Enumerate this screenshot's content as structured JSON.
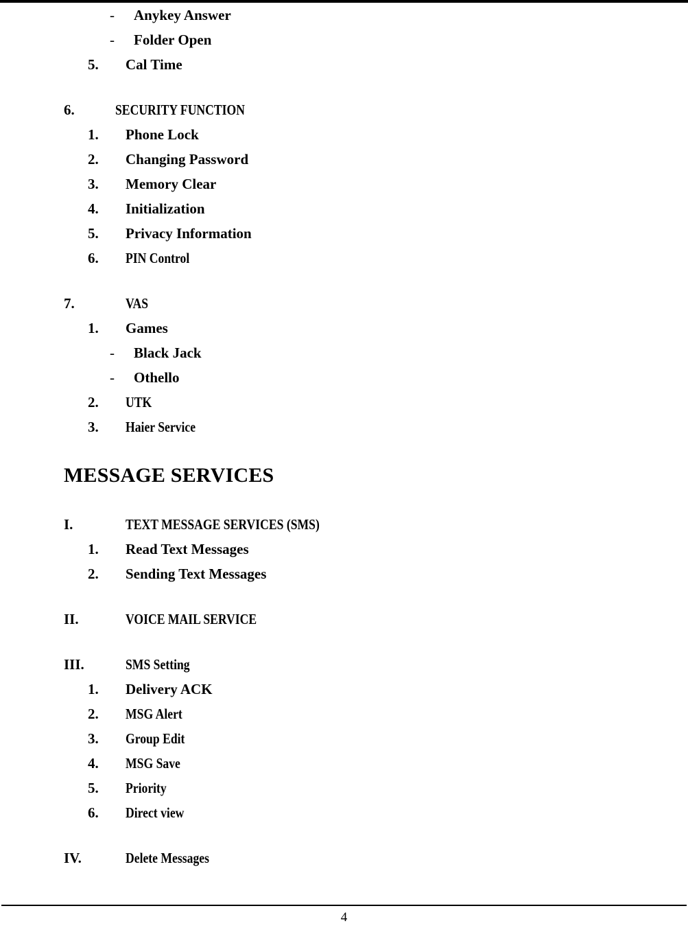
{
  "page": {
    "number": "4",
    "background_color": "#ffffff",
    "text_color": "#000000"
  },
  "continued_section": {
    "bullets": [
      {
        "marker": "-",
        "label": "Anykey Answer"
      },
      {
        "marker": "-",
        "label": "Folder Open"
      }
    ],
    "item": {
      "marker": "5.",
      "label": "Cal Time"
    }
  },
  "sections": [
    {
      "marker": "6.",
      "title": "SECURITY FUNCTION",
      "items": [
        {
          "marker": "1.",
          "label": "Phone Lock"
        },
        {
          "marker": "2.",
          "label": "Changing Password"
        },
        {
          "marker": "3.",
          "label": "Memory Clear"
        },
        {
          "marker": "4.",
          "label": "Initialization"
        },
        {
          "marker": "5.",
          "label": "Privacy Information"
        },
        {
          "marker": "6.",
          "label": "PIN Control"
        }
      ]
    },
    {
      "marker": "7.",
      "title": "VAS",
      "items": [
        {
          "marker": "1.",
          "label": "Games"
        },
        {
          "marker": "-",
          "label": "Black Jack"
        },
        {
          "marker": "-",
          "label": "Othello"
        },
        {
          "marker": "2.",
          "label": "UTK"
        },
        {
          "marker": "3.",
          "label": "Haier Service"
        }
      ]
    }
  ],
  "major_heading": "MESSAGE SERVICES",
  "message_sections": [
    {
      "marker": "I.",
      "title": "TEXT MESSAGE SERVICES (SMS)",
      "items": [
        {
          "marker": "1.",
          "label": "Read Text Messages"
        },
        {
          "marker": "2.",
          "label": "Sending Text Messages"
        }
      ]
    },
    {
      "marker": "II.",
      "title": "VOICE MAIL SERVICE",
      "items": []
    },
    {
      "marker": "III.",
      "title": "SMS Setting",
      "items": [
        {
          "marker": "1.",
          "label": "Delivery ACK"
        },
        {
          "marker": "2.",
          "label": "MSG Alert"
        },
        {
          "marker": "3.",
          "label": "Group Edit"
        },
        {
          "marker": "4.",
          "label": "MSG Save"
        },
        {
          "marker": "5.",
          "label": "Priority"
        },
        {
          "marker": "6.",
          "label": "Direct view"
        }
      ]
    },
    {
      "marker": "IV.",
      "title": "Delete Messages",
      "items": []
    }
  ]
}
